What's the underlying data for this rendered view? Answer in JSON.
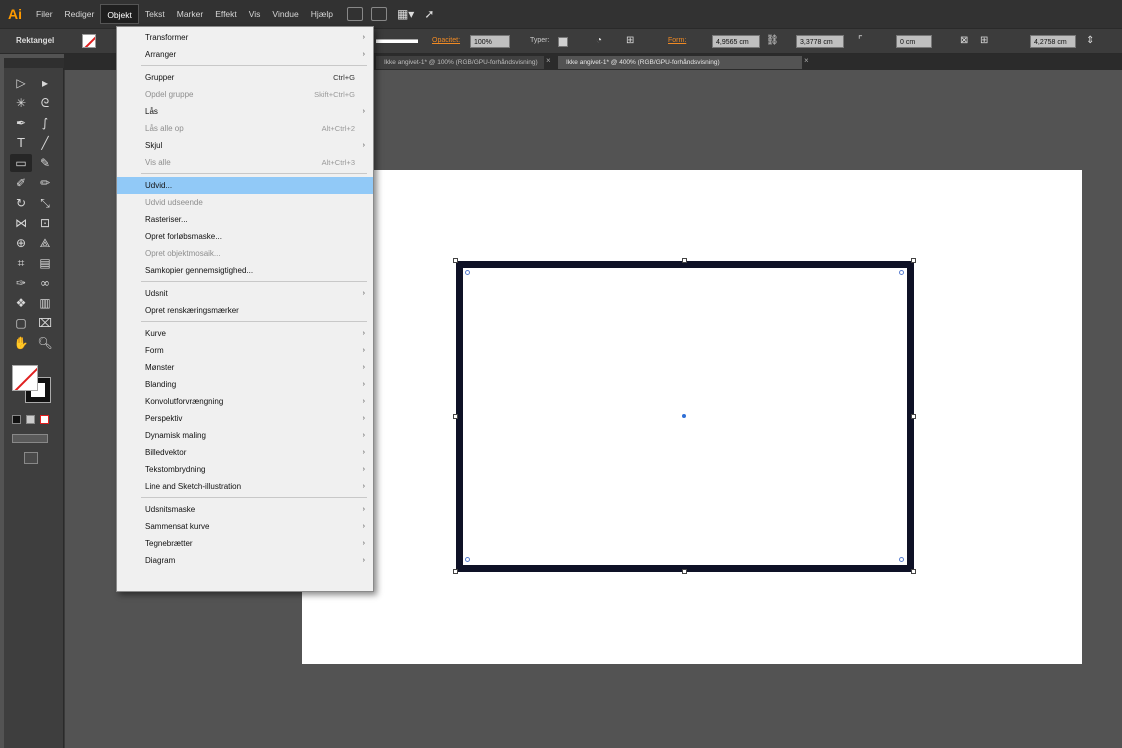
{
  "app": {
    "logo": "Ai"
  },
  "menubar": {
    "items": [
      "Filer",
      "Rediger",
      "Objekt",
      "Tekst",
      "Marker",
      "Effekt",
      "Vis",
      "Vindue",
      "Hjælp"
    ],
    "active_index": 2
  },
  "controlbar": {
    "object_type": "Rektangel",
    "opacity_label": "Opacitet:",
    "opacity_value": "100%",
    "style_label": "Typer:",
    "shape_label": "Form:",
    "width_value": "4,9565 cm",
    "height_value": "3,3778 cm",
    "x_value": "0 cm",
    "y_value": "4,2758 cm"
  },
  "tabs": [
    {
      "label": "Ikke angivet-1* @ 100% (RGB/GPU-forhåndsvisning)",
      "active": false
    },
    {
      "label": "Ikke angivet-1* @ 400% (RGB/GPU-forhåndsvisning)",
      "active": true
    }
  ],
  "objekt_menu": [
    {
      "label": "Transformer",
      "submenu": true,
      "shortcut": "",
      "disabled": false
    },
    {
      "label": "Arranger",
      "submenu": true,
      "shortcut": "",
      "disabled": false
    },
    {
      "sep": true
    },
    {
      "label": "Grupper",
      "submenu": false,
      "shortcut": "Ctrl+G",
      "disabled": false
    },
    {
      "label": "Opdel gruppe",
      "submenu": false,
      "shortcut": "Skift+Ctrl+G",
      "disabled": true
    },
    {
      "label": "Lås",
      "submenu": true,
      "shortcut": "",
      "disabled": false
    },
    {
      "label": "Lås alle op",
      "submenu": false,
      "shortcut": "Alt+Ctrl+2",
      "disabled": true
    },
    {
      "label": "Skjul",
      "submenu": true,
      "shortcut": "",
      "disabled": false
    },
    {
      "label": "Vis alle",
      "submenu": false,
      "shortcut": "Alt+Ctrl+3",
      "disabled": true
    },
    {
      "sep": true
    },
    {
      "label": "Udvid...",
      "submenu": false,
      "shortcut": "",
      "disabled": false,
      "highlight": true
    },
    {
      "label": "Udvid udseende",
      "submenu": false,
      "shortcut": "",
      "disabled": true
    },
    {
      "label": "Rasteriser...",
      "submenu": false,
      "shortcut": "",
      "disabled": false
    },
    {
      "label": "Opret forløbsmaske...",
      "submenu": false,
      "shortcut": "",
      "disabled": false
    },
    {
      "label": "Opret objektmosaik...",
      "submenu": false,
      "shortcut": "",
      "disabled": true
    },
    {
      "label": "Samkopier gennemsigtighed...",
      "submenu": false,
      "shortcut": "",
      "disabled": false
    },
    {
      "sep": true
    },
    {
      "label": "Udsnit",
      "submenu": true,
      "shortcut": "",
      "disabled": false
    },
    {
      "label": "Opret renskæringsmærker",
      "submenu": false,
      "shortcut": "",
      "disabled": false
    },
    {
      "sep": true
    },
    {
      "label": "Kurve",
      "submenu": true,
      "shortcut": "",
      "disabled": false
    },
    {
      "label": "Form",
      "submenu": true,
      "shortcut": "",
      "disabled": false
    },
    {
      "label": "Mønster",
      "submenu": true,
      "shortcut": "",
      "disabled": false
    },
    {
      "label": "Blanding",
      "submenu": true,
      "shortcut": "",
      "disabled": false
    },
    {
      "label": "Konvolutforvrængning",
      "submenu": true,
      "shortcut": "",
      "disabled": false
    },
    {
      "label": "Perspektiv",
      "submenu": true,
      "shortcut": "",
      "disabled": false
    },
    {
      "label": "Dynamisk maling",
      "submenu": true,
      "shortcut": "",
      "disabled": false
    },
    {
      "label": "Billedvektor",
      "submenu": true,
      "shortcut": "",
      "disabled": false
    },
    {
      "label": "Tekstombrydning",
      "submenu": true,
      "shortcut": "",
      "disabled": false
    },
    {
      "label": "Line and Sketch-illustration",
      "submenu": true,
      "shortcut": "",
      "disabled": false
    },
    {
      "sep": true
    },
    {
      "label": "Udsnitsmaske",
      "submenu": true,
      "shortcut": "",
      "disabled": false
    },
    {
      "label": "Sammensat kurve",
      "submenu": true,
      "shortcut": "",
      "disabled": false
    },
    {
      "label": "Tegnebrætter",
      "submenu": true,
      "shortcut": "",
      "disabled": false
    },
    {
      "label": "Diagram",
      "submenu": true,
      "shortcut": "",
      "disabled": false
    }
  ],
  "tools": [
    "selection-tool",
    "direct-selection-tool",
    "magic-wand-tool",
    "lasso-tool",
    "pen-tool",
    "curvature-tool",
    "type-tool",
    "line-segment-tool",
    "rectangle-tool",
    "paintbrush-tool",
    "shaper-tool",
    "eraser-tool",
    "rotate-tool",
    "scale-tool",
    "width-tool",
    "free-transform-tool",
    "shape-builder-tool",
    "perspective-grid-tool",
    "mesh-tool",
    "gradient-tool",
    "eyedropper-tool",
    "blend-tool",
    "symbol-sprayer-tool",
    "column-graph-tool",
    "artboard-tool",
    "slice-tool",
    "hand-tool",
    "zoom-tool"
  ],
  "colors": {
    "menu_highlight": "#91c9f7",
    "rect_stroke": "#0e1126",
    "none_slash": "#e02020",
    "logo": "#ff9a00"
  }
}
